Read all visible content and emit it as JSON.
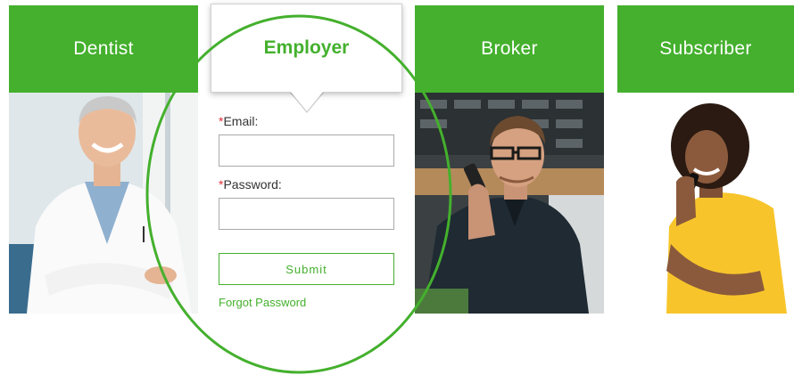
{
  "tiles": {
    "dentist": {
      "label": "Dentist"
    },
    "employer": {
      "label": "Employer"
    },
    "broker": {
      "label": "Broker"
    },
    "subscriber": {
      "label": "Subscriber"
    }
  },
  "login_form": {
    "required_marker": "*",
    "email_label": "Email:",
    "email_value": "",
    "password_label": "Password:",
    "password_value": "",
    "submit_label": "Submit",
    "forgot_label": "Forgot Password"
  },
  "colors": {
    "brand_green": "#44b02d",
    "required_red": "#e0303a",
    "highlight_oval": "#44b02d"
  },
  "photos": {
    "dentist": "smiling-dentist-in-white-coat",
    "broker": "man-with-glasses-on-phone",
    "subscriber": "woman-in-yellow-top-on-phone"
  }
}
